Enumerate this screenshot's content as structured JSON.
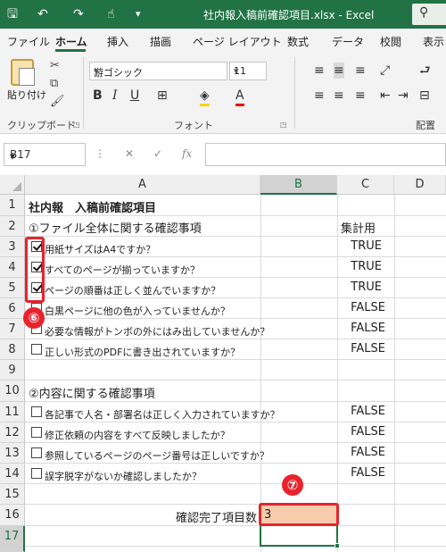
{
  "titlebar": {
    "title": "社内報入稿前確認項目.xlsx  -  Excel",
    "qa_icons": [
      "save-icon",
      "undo-icon",
      "redo-icon",
      "touch-mode-icon",
      "customize-icon"
    ]
  },
  "tabs": [
    "ファイル",
    "ホーム",
    "挿入",
    "描画",
    "ページ レイアウト",
    "数式",
    "データ",
    "校閲",
    "表示"
  ],
  "active_tab": "ホーム",
  "ribbon": {
    "clipboard": {
      "paste_label": "貼り付け",
      "group_label": "クリップボード"
    },
    "font": {
      "font_name": "游ゴシック",
      "font_size": "11",
      "group_label": "フォント",
      "bold": "B",
      "italic": "I",
      "underline": "U",
      "grow": "A",
      "shrink": "A",
      "color": "A"
    },
    "alignment": {
      "group_label": "配置",
      "wrap_label": "折"
    }
  },
  "formula_bar": {
    "name_box": "B17",
    "fx": "fx",
    "cancel": "✕",
    "enter": "✓",
    "value": ""
  },
  "columns": [
    "A",
    "B",
    "C",
    "D"
  ],
  "selected_column": "B",
  "rows": [
    "1",
    "2",
    "3",
    "4",
    "5",
    "6",
    "7",
    "8",
    "9",
    "10",
    "11",
    "12",
    "13",
    "14",
    "15",
    "16",
    "17"
  ],
  "selected_row": "17",
  "sheet": {
    "r1": "社内報　入稿前確認項目",
    "r2": "①ファイル全体に関する確認事項",
    "r2c": "集計用",
    "r3": "用紙サイズはA4ですか？",
    "r3c": "TRUE",
    "r4": "すべてのページが揃っていますか？",
    "r4c": "TRUE",
    "r5": "ページの順番は正しく並んでいますか？",
    "r5c": "TRUE",
    "r6": "白黒ページに他の色が入っていませんか？",
    "r6c": "FALSE",
    "r7": "必要な情報がトンボの外にはみ出していませんか？",
    "r7c": "FALSE",
    "r8": "正しい形式のPDFに書き出されていますか？",
    "r8c": "FALSE",
    "r10": "②内容に関する確認事項",
    "r11": "各記事で人名・部署名は正しく入力されていますか？",
    "r11c": "FALSE",
    "r12": "修正依頼の内容をすべて反映しましたか？",
    "r12c": "FALSE",
    "r13": "参照しているページのページ番号は正しいですか？",
    "r13c": "FALSE",
    "r14": "誤字脱字がないか確認しましたか？",
    "r14c": "FALSE",
    "r16a": "確認完了項目数",
    "r16b": "3"
  },
  "annotations": {
    "badge6": "⑥",
    "badge7": "⑦"
  },
  "colors": {
    "excel_green": "#217346",
    "annotation_red": "#e8232d",
    "highlight_orange": "#f8cbad"
  }
}
